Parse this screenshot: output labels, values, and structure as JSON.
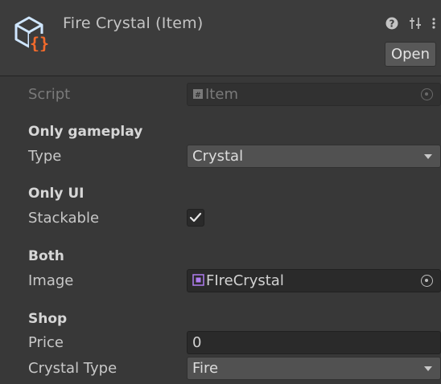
{
  "header": {
    "title": "Fire Crystal (Item)",
    "open_label": "Open",
    "icons": [
      "scriptable-object-icon",
      "help-icon",
      "preset-icon",
      "kebab-menu-icon"
    ]
  },
  "fields": {
    "script": {
      "label": "Script",
      "value": "Item"
    },
    "sections": {
      "gameplay": "Only gameplay",
      "ui": "Only UI",
      "both": "Both",
      "shop": "Shop"
    },
    "type": {
      "label": "Type",
      "value": "Crystal"
    },
    "stackable": {
      "label": "Stackable",
      "checked": true
    },
    "image": {
      "label": "Image",
      "value": "FIreCrystal"
    },
    "price": {
      "label": "Price",
      "value": "0"
    },
    "crystal_type": {
      "label": "Crystal Type",
      "value": "Fire"
    }
  },
  "colors": {
    "accent_orange": "#f26a2b",
    "icon_blue": "#9fd0ff",
    "sprite_purple": "#b07cf0"
  }
}
